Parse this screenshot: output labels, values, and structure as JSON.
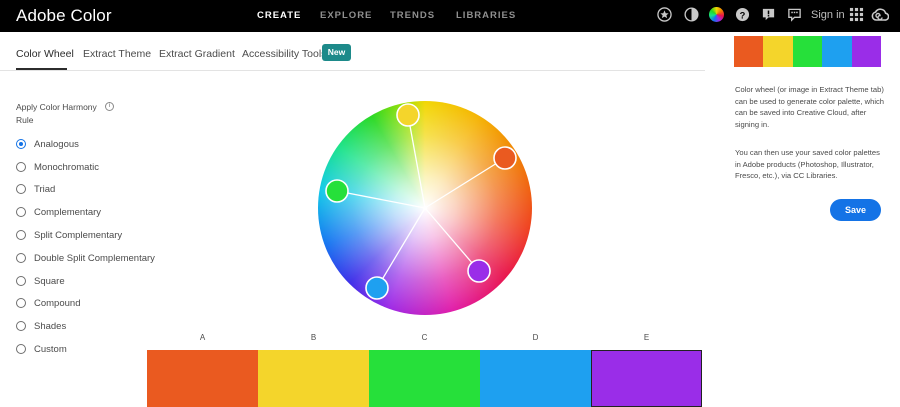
{
  "app": {
    "title": "Adobe Color"
  },
  "nav": [
    {
      "label": "CREATE",
      "active": true
    },
    {
      "label": "EXPLORE",
      "active": false
    },
    {
      "label": "TRENDS",
      "active": false
    },
    {
      "label": "LIBRARIES",
      "active": false
    }
  ],
  "topbar": {
    "icons": [
      "star-icon",
      "theme-toggle-icon",
      "color-wheel-icon",
      "help-icon",
      "alert-icon",
      "feedback-icon"
    ],
    "signin_label": "Sign in",
    "apps_icon": "apps-grid-icon",
    "cc_icon": "creative-cloud-icon"
  },
  "tabs": [
    {
      "label": "Color Wheel",
      "active": true
    },
    {
      "label": "Extract Theme",
      "active": false
    },
    {
      "label": "Extract Gradient",
      "active": false
    },
    {
      "label": "Accessibility Tools",
      "active": false
    }
  ],
  "new_badge": "New",
  "harmony": {
    "heading": "Apply Color Harmony Rule",
    "info_icon": "info-icon",
    "rules": [
      {
        "label": "Analogous",
        "selected": true
      },
      {
        "label": "Monochromatic",
        "selected": false
      },
      {
        "label": "Triad",
        "selected": false
      },
      {
        "label": "Complementary",
        "selected": false
      },
      {
        "label": "Split Complementary",
        "selected": false
      },
      {
        "label": "Double Split Complementary",
        "selected": false
      },
      {
        "label": "Square",
        "selected": false
      },
      {
        "label": "Compound",
        "selected": false
      },
      {
        "label": "Shades",
        "selected": false
      },
      {
        "label": "Custom",
        "selected": false
      }
    ]
  },
  "palette": {
    "swatches": [
      {
        "label": "A",
        "color": "#ea5a20"
      },
      {
        "label": "B",
        "color": "#f4d52b"
      },
      {
        "label": "C",
        "color": "#26e03a"
      },
      {
        "label": "D",
        "color": "#1ea0f0"
      },
      {
        "label": "E",
        "color": "#9a2de8"
      }
    ]
  },
  "side_panel": {
    "description": "Color wheel (or image in Extract Theme tab) can be used to generate color palette, which can be saved into Creative Cloud, after signing in.",
    "description2": "You can then use your saved color palettes in Adobe products (Photoshop, Illustrator, Fresco, etc.), via CC Libraries.",
    "save_label": "Save"
  },
  "colors": {
    "accent": "#1473e6",
    "badge": "#1d8a8a",
    "topbar": "#000000"
  }
}
